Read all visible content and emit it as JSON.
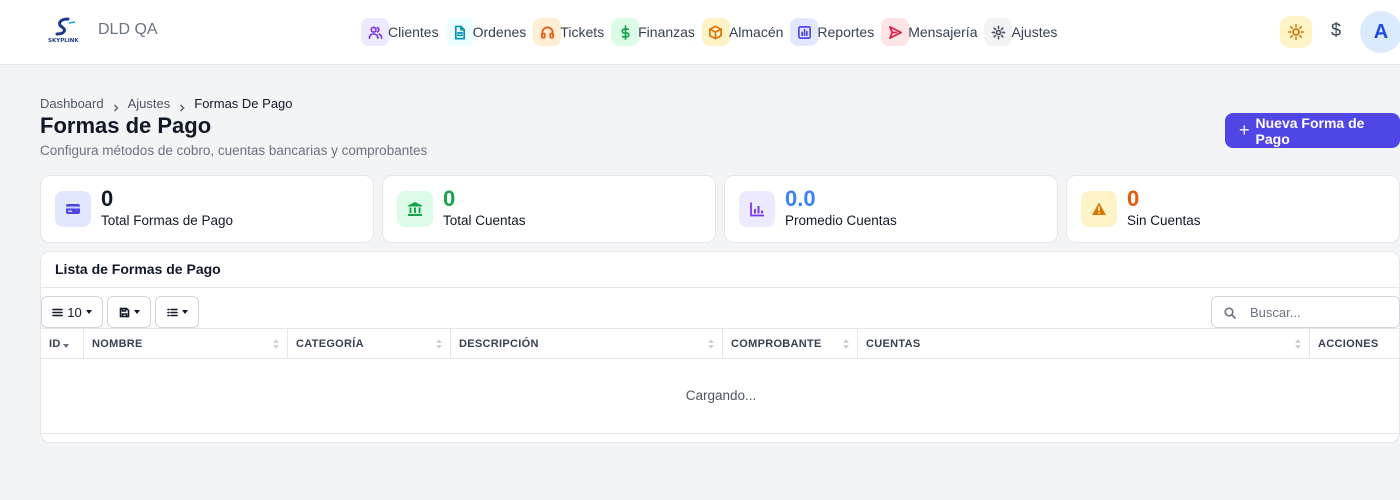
{
  "app": {
    "name": "DLD QA",
    "logo_text": "SKYPLINK"
  },
  "nav": {
    "items": [
      {
        "label": "Clientes",
        "icon": "users-icon",
        "color": "#7c3aed",
        "bg": "#ede9fe"
      },
      {
        "label": "Ordenes",
        "icon": "document-icon",
        "color": "#0891b2",
        "bg": "#ecfeff"
      },
      {
        "label": "Tickets",
        "icon": "headset-icon",
        "color": "#ea580c",
        "bg": "#ffedd5"
      },
      {
        "label": "Finanzas",
        "icon": "dollar-icon",
        "color": "#16a34a",
        "bg": "#dcfce7"
      },
      {
        "label": "Almacén",
        "icon": "box-icon",
        "color": "#d97706",
        "bg": "#fef3c7"
      },
      {
        "label": "Reportes",
        "icon": "bar-chart-icon",
        "color": "#4f46e5",
        "bg": "#e0e7ff"
      },
      {
        "label": "Mensajería",
        "icon": "send-icon",
        "color": "#e11d48",
        "bg": "#ffe4e6"
      },
      {
        "label": "Ajustes",
        "icon": "gear-icon",
        "color": "#4b5563",
        "bg": "#f3f4f6"
      }
    ]
  },
  "header_actions": {
    "theme_icon": "sun-icon",
    "currency_symbol": "$",
    "avatar_initial": "A"
  },
  "breadcrumb": [
    "Dashboard",
    "Ajustes",
    "Formas De Pago"
  ],
  "page": {
    "title": "Formas de Pago",
    "subtitle": "Configura métodos de cobro, cuentas bancarias y comprobantes",
    "primary_action": "Nueva Forma de Pago"
  },
  "stats": [
    {
      "value": "0",
      "label": "Total Formas de Pago",
      "icon": "credit-card-icon",
      "color": "#4f46e5",
      "bg": "#e0e7ff",
      "value_color": "#111827"
    },
    {
      "value": "0",
      "label": "Total Cuentas",
      "icon": "bank-icon",
      "color": "#16a34a",
      "bg": "#dcfce7",
      "value_color": "#16a34a"
    },
    {
      "value": "0.0",
      "label": "Promedio Cuentas",
      "icon": "chart-icon",
      "color": "#7c3aed",
      "bg": "#ede9fe",
      "value_color": "#3b82f6"
    },
    {
      "value": "0",
      "label": "Sin Cuentas",
      "icon": "warning-icon",
      "color": "#d97706",
      "bg": "#fef3c7",
      "value_color": "#ea580c"
    }
  ],
  "table": {
    "title": "Lista de Formas de Pago",
    "page_size": "10",
    "search_placeholder": "Buscar...",
    "columns": [
      "ID",
      "NOMBRE",
      "CATEGORÍA",
      "DESCRIPCIÓN",
      "COMPROBANTE",
      "CUENTAS",
      "ACCIONES"
    ],
    "loading_text": "Cargando..."
  }
}
